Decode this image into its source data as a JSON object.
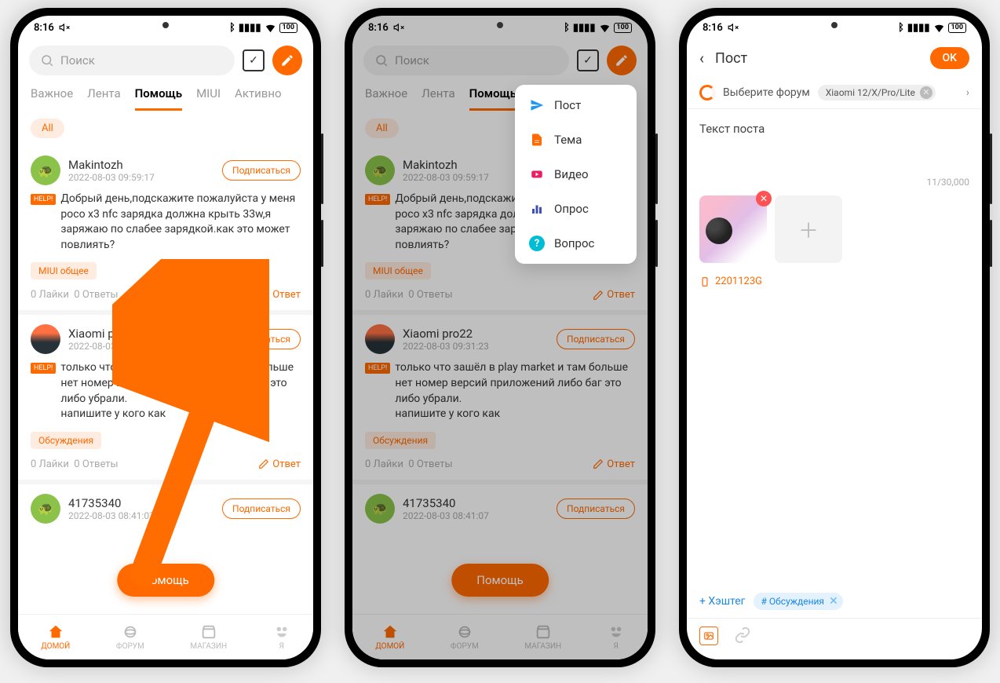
{
  "statusbar": {
    "time": "8:16",
    "battery": "100"
  },
  "search": {
    "placeholder": "Поиск"
  },
  "tabs": [
    "Важное",
    "Лента",
    "Помощь",
    "MIUI",
    "Активно"
  ],
  "active_tab_index": 2,
  "filter_chip": "All",
  "subscribe_label": "Подписаться",
  "reply_label": "Ответ",
  "help_badge": "HELP!",
  "posts": [
    {
      "user": "Makintozh",
      "time": "2022-08-03 09:59:17",
      "text": "Добрый день,подскажите пожалуйста у меня poco x3 nfc зарядка должна крыть 33w,я заряжаю по слабее зарядкой.как это может повлиять?",
      "tag": "MIUI общее",
      "likes": "0 Лайки",
      "replies": "0 Ответы"
    },
    {
      "user": "Xiaomi pro22",
      "time": "2022-08-03 09:31:23",
      "text": "только что зашёл в play market и там больше нет номер версий приложений либо баг это либо убрали.\nнапишите у кого как",
      "tag": "Обсуждения",
      "likes": "0 Лайки",
      "replies": "0 Ответы"
    },
    {
      "user": "41735340",
      "time": "2022-08-03 08:41:07",
      "text": "",
      "tag": "",
      "likes": "",
      "replies": ""
    }
  ],
  "fab_label": "Помощь",
  "bottomnav": [
    "ДОМОЙ",
    "ФОРУМ",
    "МАГАЗИН",
    "Я"
  ],
  "dropdown": [
    {
      "label": "Пост",
      "color": "#2196f3"
    },
    {
      "label": "Тема",
      "color": "#ff6900"
    },
    {
      "label": "Видео",
      "color": "#e91e63"
    },
    {
      "label": "Опрос",
      "color": "#3f51b5"
    },
    {
      "label": "Вопрос",
      "color": "#00bcd4"
    }
  ],
  "compose": {
    "title": "Пост",
    "ok": "OK",
    "select_forum": "Выберите форум",
    "forum_chip": "Xiaomi 12/X/Pro/Lite",
    "text": "Текст поста",
    "char_count": "11/30,000",
    "device": "2201123G",
    "add_hashtag": "+ Хэштег",
    "hashtag": "# Обсуждения"
  }
}
